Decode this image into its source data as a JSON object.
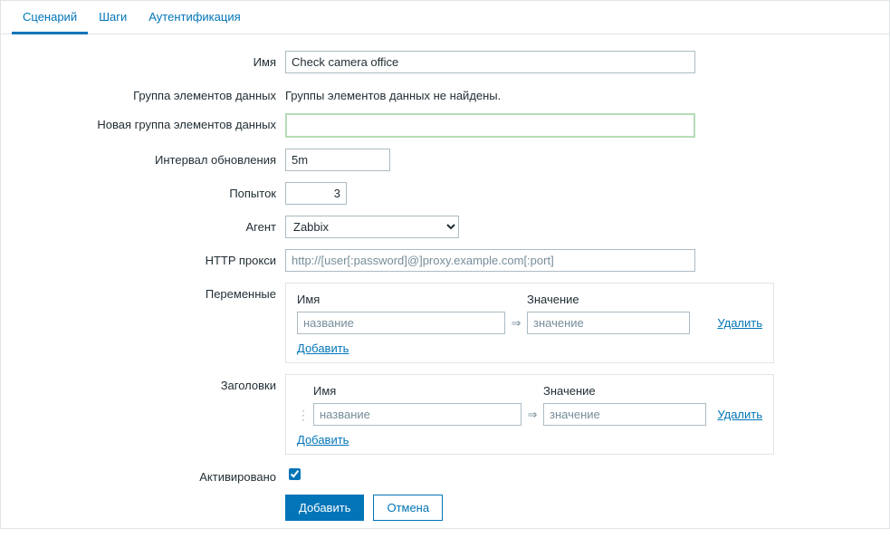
{
  "tabs": {
    "scenario": "Сценарий",
    "steps": "Шаги",
    "auth": "Аутентификация"
  },
  "labels": {
    "name": "Имя",
    "application": "Группа элементов данных",
    "new_application": "Новая группа элементов данных",
    "update_interval": "Интервал обновления",
    "attempts": "Попыток",
    "agent": "Агент",
    "http_proxy": "HTTP прокси",
    "variables": "Переменные",
    "headers": "Заголовки",
    "enabled": "Активировано"
  },
  "fields": {
    "name_value": "Check camera office",
    "application_text": "Группы элементов данных не найдены.",
    "new_application_value": "",
    "update_interval_value": "5m",
    "attempts_value": "3",
    "agent_value": "Zabbix",
    "http_proxy_value": "",
    "http_proxy_placeholder": "http://[user[:password]@]proxy.example.com[:port]",
    "enabled_checked": true
  },
  "subtable": {
    "col_name": "Имя",
    "col_value": "Значение",
    "ph_name": "название",
    "ph_value": "значение",
    "delete": "Удалить",
    "add": "Добавить",
    "arrow": "⇒"
  },
  "buttons": {
    "submit": "Добавить",
    "cancel": "Отмена"
  }
}
